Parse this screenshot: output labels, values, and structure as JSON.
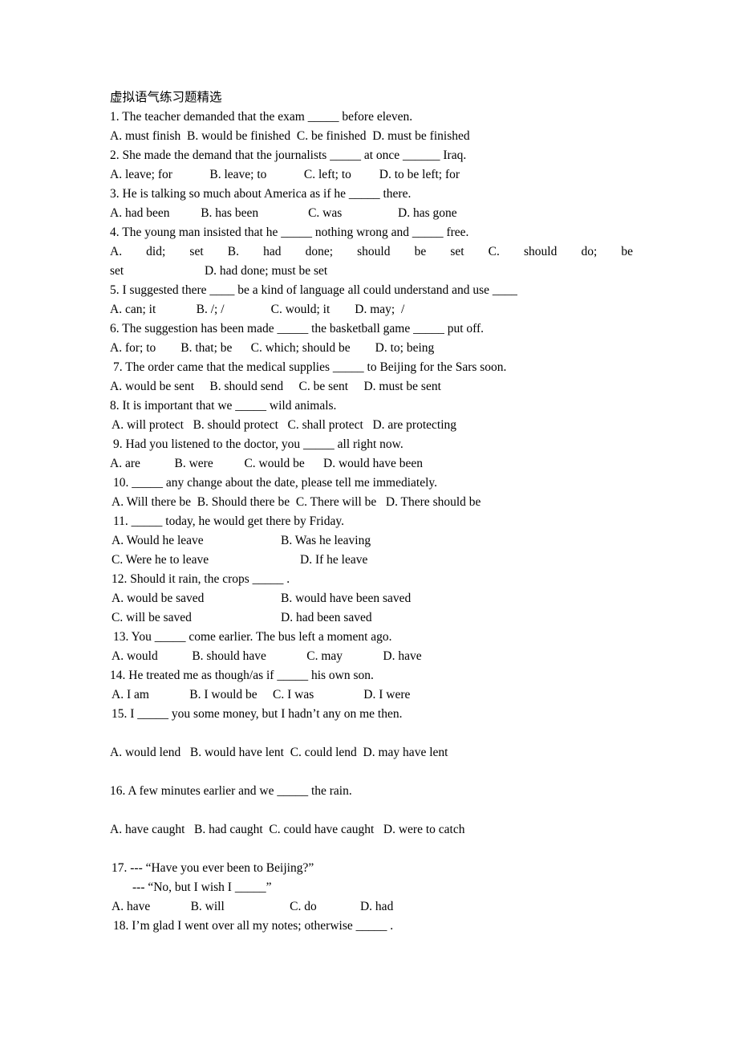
{
  "document": {
    "title": "虚拟语气练习题精选",
    "lines": [
      {
        "id": "q1-stem",
        "text": "1. The teacher demanded that the exam _____ before eleven.",
        "indent": "ind-0"
      },
      {
        "id": "q1-opts",
        "text": "A. must finish  B. would be finished  C. be finished  D. must be finished",
        "indent": "ind-0"
      },
      {
        "id": "q2-stem",
        "text": "2. She made the demand that the journalists _____ at once ______ Iraq.",
        "indent": "ind-0"
      },
      {
        "id": "q2-opts",
        "text": "A. leave; for            B. leave; to            C. left; to         D. to be left; for",
        "indent": "ind-0"
      },
      {
        "id": "q3-stem",
        "text": "3. He is talking so much about America as if he _____ there.",
        "indent": "ind-0"
      },
      {
        "id": "q3-opts",
        "text": "A. had been          B. has been                C. was                  D. has gone",
        "indent": "ind-0"
      },
      {
        "id": "q4-stem",
        "text": "4. The young man insisted that he _____ nothing wrong and _____ free.",
        "indent": "ind-0"
      },
      {
        "id": "q4-opts-b",
        "text": "D. had done; must be set",
        "indent": "ind-0"
      },
      {
        "id": "q5-stem",
        "text": "5. I suggested there ____ be a kind of language all could understand and use ____",
        "indent": "ind-0"
      },
      {
        "id": "q5-opts",
        "text": "A. can; it             B. /; /               C. would; it        D. may;  /",
        "indent": "ind-0"
      },
      {
        "id": "q6-stem",
        "text": "6. The suggestion has been made _____ the basketball game _____ put off.",
        "indent": "ind-0"
      },
      {
        "id": "q6-opts",
        "text": "A. for; to        B. that; be      C. which; should be        D. to; being",
        "indent": "ind-0"
      },
      {
        "id": "q7-stem",
        "text": "7. The order came that the medical supplies _____ to Beijing for the Sars soon.",
        "indent": "ind-2"
      },
      {
        "id": "q7-opts",
        "text": "A. would be sent     B. should send     C. be sent     D. must be sent",
        "indent": "ind-0"
      },
      {
        "id": "q8-stem",
        "text": "8. It is important that we _____ wild animals.",
        "indent": "ind-0"
      },
      {
        "id": "q8-opts",
        "text": "A. will protect   B. should protect   C. shall protect   D. are protecting",
        "indent": "ind-1"
      },
      {
        "id": "q9-stem",
        "text": "9. Had you listened to the doctor, you _____ all right now.",
        "indent": "ind-2"
      },
      {
        "id": "q9-opts",
        "text": "A. are           B. were          C. would be      D. would have been",
        "indent": "ind-0"
      },
      {
        "id": "q10-stem",
        "text": "10. _____ any change about the date, please tell me immediately.",
        "indent": "ind-2"
      },
      {
        "id": "q10-opts",
        "text": "A. Will there be  B. Should there be  C. There will be   D. There should be",
        "indent": "ind-1"
      },
      {
        "id": "q11-stem",
        "text": "11. _____ today, he would get there by Friday.",
        "indent": "ind-2"
      },
      {
        "id": "q12-stem",
        "text": "12. Should it rain, the crops _____ .",
        "indent": "ind-1"
      },
      {
        "id": "q13-stem",
        "text": "13. You _____ come earlier. The bus left a moment ago.",
        "indent": "ind-2"
      },
      {
        "id": "q13-opts",
        "text": "A. would           B. should have             C. may             D. have",
        "indent": "ind-1"
      },
      {
        "id": "q14-stem",
        "text": "14. He treated me as though/as if _____ his own son.",
        "indent": "ind-0"
      },
      {
        "id": "q14-opts",
        "text": "A. I am             B. I would be     C. I was                D. I were",
        "indent": "ind-1"
      },
      {
        "id": "q15-stem",
        "text": "15. I _____ you some money, but I hadn’t any on me then.",
        "indent": "ind-1"
      },
      {
        "id": "q15-opts",
        "text": "A. would lend   B. would have lent  C. could lend  D. may have lent",
        "indent": "ind-0"
      },
      {
        "id": "q16-stem",
        "text": "16. A few minutes earlier and we _____ the rain.",
        "indent": "ind-0"
      },
      {
        "id": "q16-opts",
        "text": "A. have caught   B. had caught  C. could have caught   D. were to catch",
        "indent": "ind-0"
      },
      {
        "id": "q17-stem",
        "text": "17. --- “Have you ever been to Beijing?”",
        "indent": "ind-1"
      },
      {
        "id": "q17-stem2",
        "text": "--- “No, but I wish I _____”",
        "indent": "ind-dlg"
      },
      {
        "id": "q17-opts",
        "text": "A. have             B. will                     C. do              D. had",
        "indent": "ind-1"
      },
      {
        "id": "q18-stem",
        "text": "18. I’m glad I went over all my notes; otherwise _____ .",
        "indent": "ind-2"
      }
    ],
    "q4_justified_options": "A.  did;  set                                 B.  had  done;  should  be  set     C.  should  do;  be",
    "q4_wrap_word": "set",
    "q11_options": {
      "rowA": {
        "left": "A. Would he leave",
        "right": "B. Was he leaving"
      },
      "rowB": {
        "left": "C. Were he to leave",
        "right": "D. If he leave"
      }
    },
    "q12_options": {
      "rowA": {
        "left": "A. would be saved",
        "right": "B. would have been saved"
      },
      "rowB": {
        "left": "C. will be saved",
        "right": "D. had been saved"
      }
    }
  }
}
